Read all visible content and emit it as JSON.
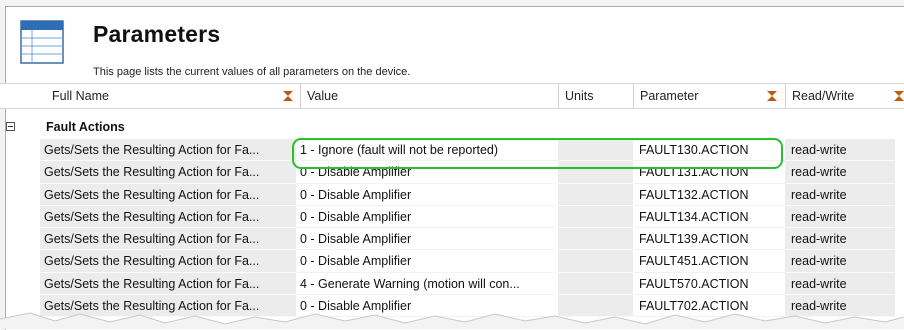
{
  "header": {
    "title": "Parameters",
    "subtitle": "This page lists the current values of all parameters on the device.",
    "icon": "table-icon"
  },
  "columns": [
    {
      "label": "Full Name",
      "filter": true
    },
    {
      "label": "Value",
      "filter": false
    },
    {
      "label": "Units",
      "filter": false
    },
    {
      "label": "Parameter",
      "filter": true
    },
    {
      "label": "Read/Write",
      "filter": true
    }
  ],
  "group": {
    "label": "Fault Actions",
    "expanded": true
  },
  "rows": [
    {
      "full_name": "Gets/Sets the Resulting Action for Fa...",
      "value": "1 - Ignore (fault will not be reported)",
      "units": "",
      "parameter": "FAULT130.ACTION",
      "rw": "read-write"
    },
    {
      "full_name": "Gets/Sets the Resulting Action for Fa...",
      "value": "0 - Disable Amplifier",
      "units": "",
      "parameter": "FAULT131.ACTION",
      "rw": "read-write"
    },
    {
      "full_name": "Gets/Sets the Resulting Action for Fa...",
      "value": "0 - Disable Amplifier",
      "units": "",
      "parameter": "FAULT132.ACTION",
      "rw": "read-write"
    },
    {
      "full_name": "Gets/Sets the Resulting Action for Fa...",
      "value": "0 - Disable Amplifier",
      "units": "",
      "parameter": "FAULT134.ACTION",
      "rw": "read-write"
    },
    {
      "full_name": "Gets/Sets the Resulting Action for Fa...",
      "value": "0 - Disable Amplifier",
      "units": "",
      "parameter": "FAULT139.ACTION",
      "rw": "read-write"
    },
    {
      "full_name": "Gets/Sets the Resulting Action for Fa...",
      "value": "0 - Disable Amplifier",
      "units": "",
      "parameter": "FAULT451.ACTION",
      "rw": "read-write"
    },
    {
      "full_name": "Gets/Sets the Resulting Action for Fa...",
      "value": "4 - Generate Warning (motion will con...",
      "units": "",
      "parameter": "FAULT570.ACTION",
      "rw": "read-write"
    },
    {
      "full_name": "Gets/Sets the Resulting Action for Fa...",
      "value": "0 - Disable Amplifier",
      "units": "",
      "parameter": "FAULT702.ACTION",
      "rw": "read-write"
    }
  ],
  "highlight_color": "#27c12f"
}
